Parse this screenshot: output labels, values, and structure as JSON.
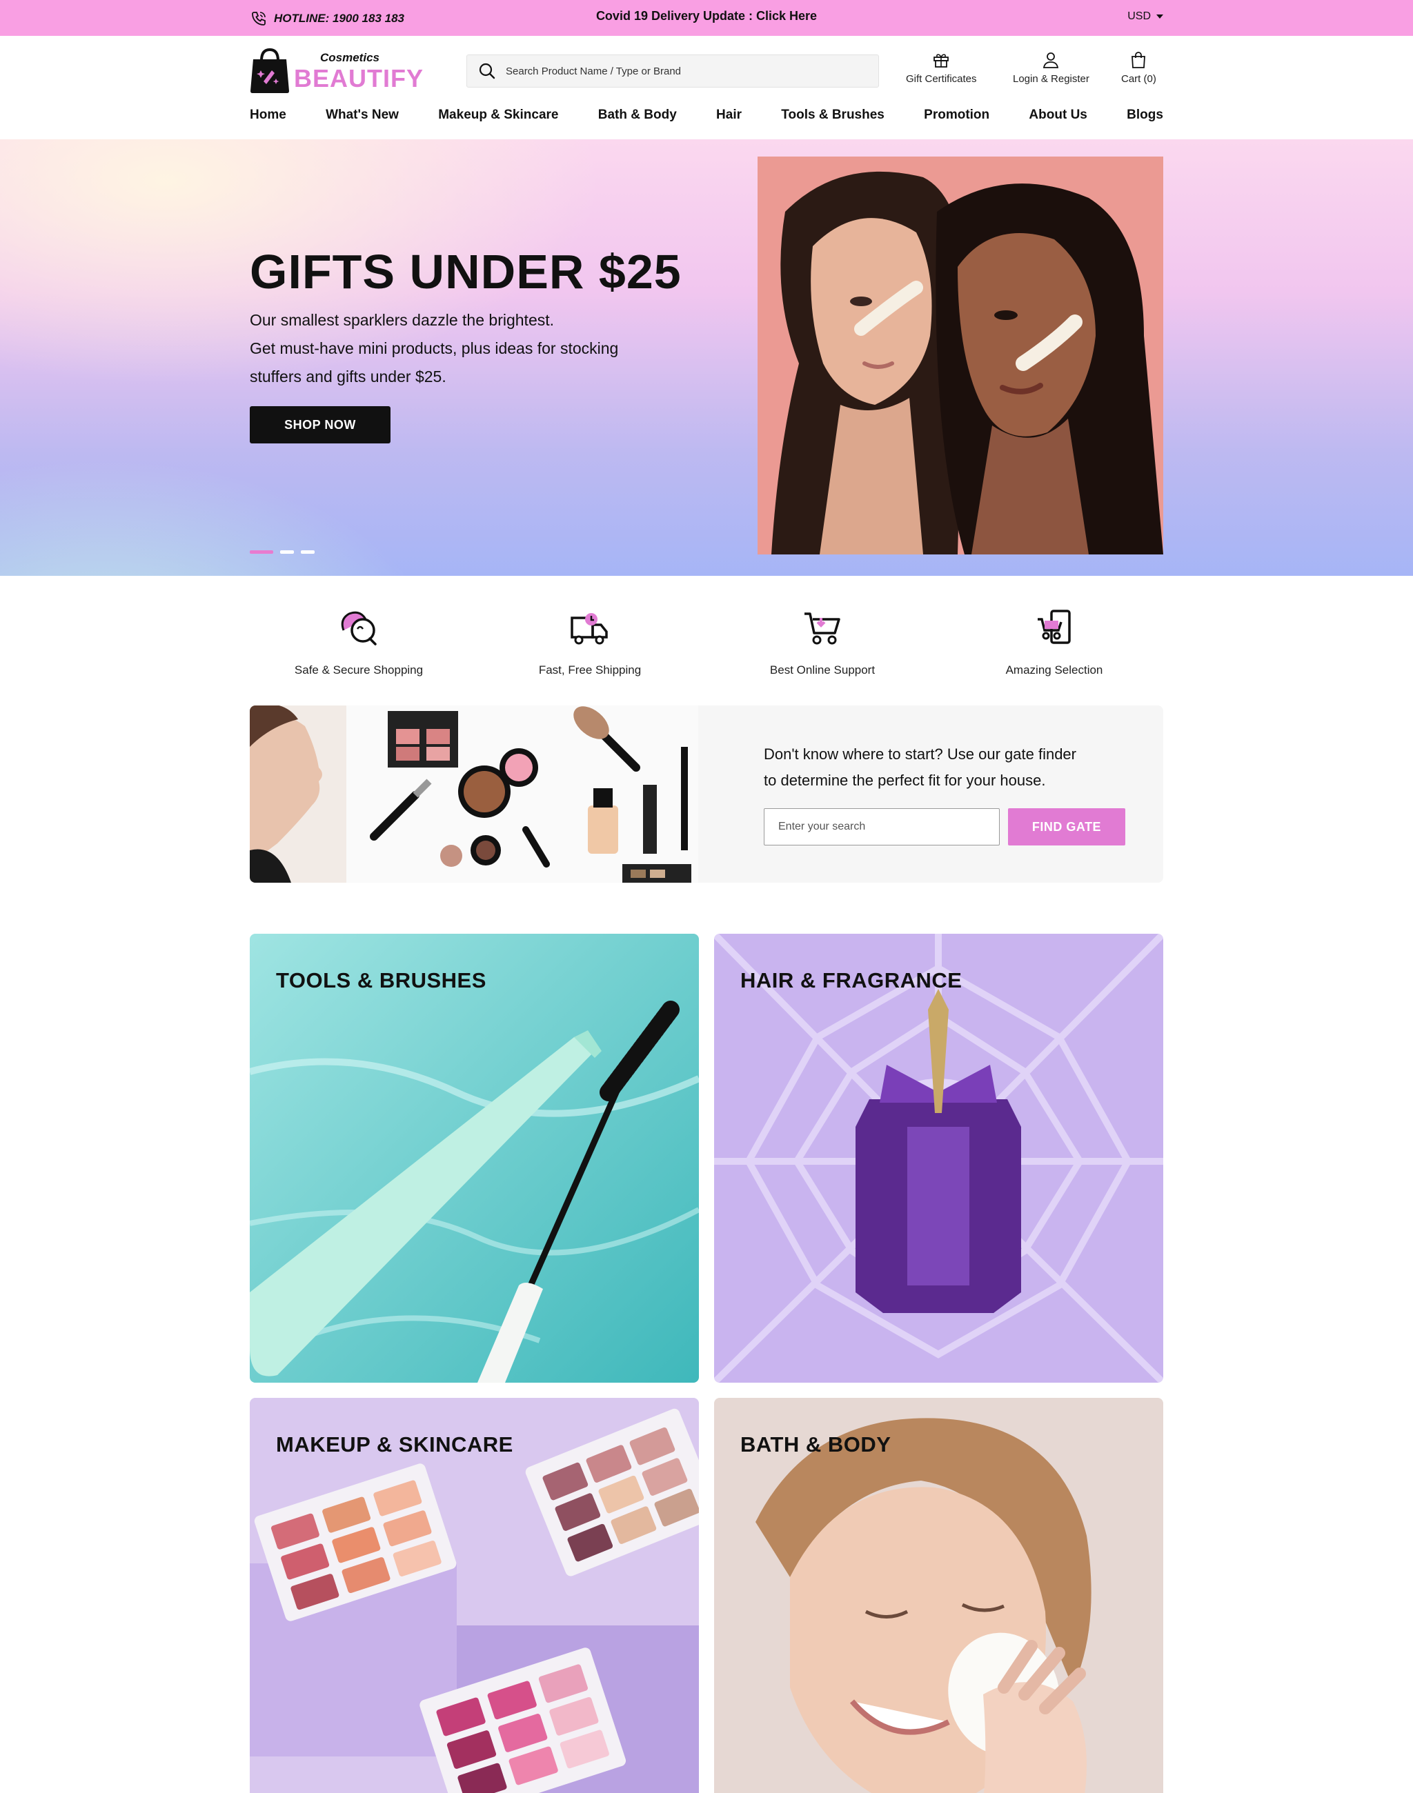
{
  "topbar": {
    "hotline": "HOTLINE: 1900 183 183",
    "announcement": "Covid 19 Delivery Update : Click Here",
    "currency": "USD"
  },
  "header": {
    "logo_small": "Cosmetics",
    "logo_big": "BEAUTIFY",
    "search_placeholder": "Search Product Name / Type or Brand",
    "gift": "Gift Certificates",
    "login": "Login & Register",
    "cart": "Cart (0)"
  },
  "nav": [
    "Home",
    "What's New",
    "Makeup & Skincare",
    "Bath & Body",
    "Hair",
    "Tools & Brushes",
    "Promotion",
    "About Us",
    "Blogs"
  ],
  "hero": {
    "title": "GIFTS UNDER $25",
    "lines": [
      "Our smallest sparklers dazzle the brightest.",
      "Get must-have mini products, plus ideas for stocking",
      "stuffers and gifts under $25."
    ],
    "button": "SHOP NOW",
    "slide_count": 3,
    "active_slide": 1
  },
  "features": [
    {
      "label": "Safe & Secure Shopping",
      "icon": "chat-bubbles-icon"
    },
    {
      "label": "Fast, Free Shipping",
      "icon": "delivery-truck-icon"
    },
    {
      "label": "Best Online Support",
      "icon": "cart-icon"
    },
    {
      "label": "Amazing Selection",
      "icon": "mobile-cart-icon"
    }
  ],
  "finder": {
    "lines": [
      "Don't know where to start? Use our gate finder",
      "to determine the perfect fit for your house."
    ],
    "input_placeholder": "Enter your search",
    "button": "FIND GATE"
  },
  "categories": [
    {
      "title": "TOOLS & BRUSHES"
    },
    {
      "title": "HAIR & FRAGRANCE"
    },
    {
      "title": "MAKEUP & SKINCARE"
    },
    {
      "title": "BATH & BODY"
    }
  ],
  "colors": {
    "topbar": "#f99fe3",
    "accent": "#e17bd3",
    "dark": "#111111"
  }
}
